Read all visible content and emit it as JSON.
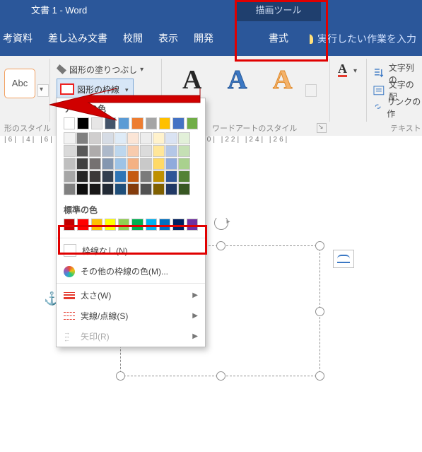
{
  "title": "文書 1  -  Word",
  "contextual": {
    "group": "描画ツール",
    "tab": "書式"
  },
  "tabs": [
    "考資料",
    "差し込み文書",
    "校閲",
    "表示",
    "開発"
  ],
  "tellme_placeholder": "実行したい作業を入力",
  "shape_styles": {
    "chip_text": "Abc",
    "fill_label": "図形の塗りつぶし",
    "outline_label": "図形の枠線",
    "group_label": "形のスタイル"
  },
  "wordart": {
    "glyphs": [
      "A",
      "A",
      "A"
    ],
    "group_label": "ワードアートのスタイル"
  },
  "text_group": {
    "direction_label": "文字列の",
    "align_label": "文字の配",
    "link_label": "リンクの作",
    "group_label": "テキスト",
    "font_fill_glyph": "A"
  },
  "ruler_text": "|6|  |4|          |6|   |8|   |10|   |12|   |14|   |16|   |18|   |20|      |22|   |24|   |26|",
  "dropdown": {
    "theme_label": "テーマの色",
    "theme_row": [
      "#ffffff",
      "#000000",
      "#e7e6e6",
      "#44546a",
      "#5b9bd5",
      "#ed7d31",
      "#a5a5a5",
      "#ffc000",
      "#4472c4",
      "#70ad47"
    ],
    "theme_grid": [
      "#f2f2f2",
      "#808080",
      "#d0cece",
      "#d6dce5",
      "#deebf7",
      "#fbe5d6",
      "#ededed",
      "#fff2cc",
      "#dae3f3",
      "#e2f0d9",
      "#d9d9d9",
      "#595959",
      "#aeabab",
      "#adb9ca",
      "#bdd7ee",
      "#f8cbad",
      "#dbdbdb",
      "#ffe699",
      "#b4c7e7",
      "#c5e0b4",
      "#bfbfbf",
      "#404040",
      "#757171",
      "#8497b0",
      "#9dc3e6",
      "#f4b183",
      "#c9c9c9",
      "#ffd966",
      "#8faadc",
      "#a9d18e",
      "#a6a6a6",
      "#262626",
      "#3b3838",
      "#333f50",
      "#2e75b6",
      "#c55a11",
      "#7b7b7b",
      "#bf9000",
      "#2f5597",
      "#548235",
      "#808080",
      "#0d0d0d",
      "#181717",
      "#222a35",
      "#1f4e79",
      "#843c0c",
      "#525252",
      "#806000",
      "#203864",
      "#385723"
    ],
    "standard_label": "標準の色",
    "standard_row": [
      "#c00000",
      "#ff0000",
      "#ffc000",
      "#ffff00",
      "#92d050",
      "#00b050",
      "#00b0f0",
      "#0070c0",
      "#002060",
      "#7030a0"
    ],
    "no_outline": "枠線なし(N)",
    "more_colors": "その他の枠線の色(M)...",
    "weight": "太さ(W)",
    "dashes": "実線/点線(S)",
    "arrows": "矢印(R)"
  }
}
